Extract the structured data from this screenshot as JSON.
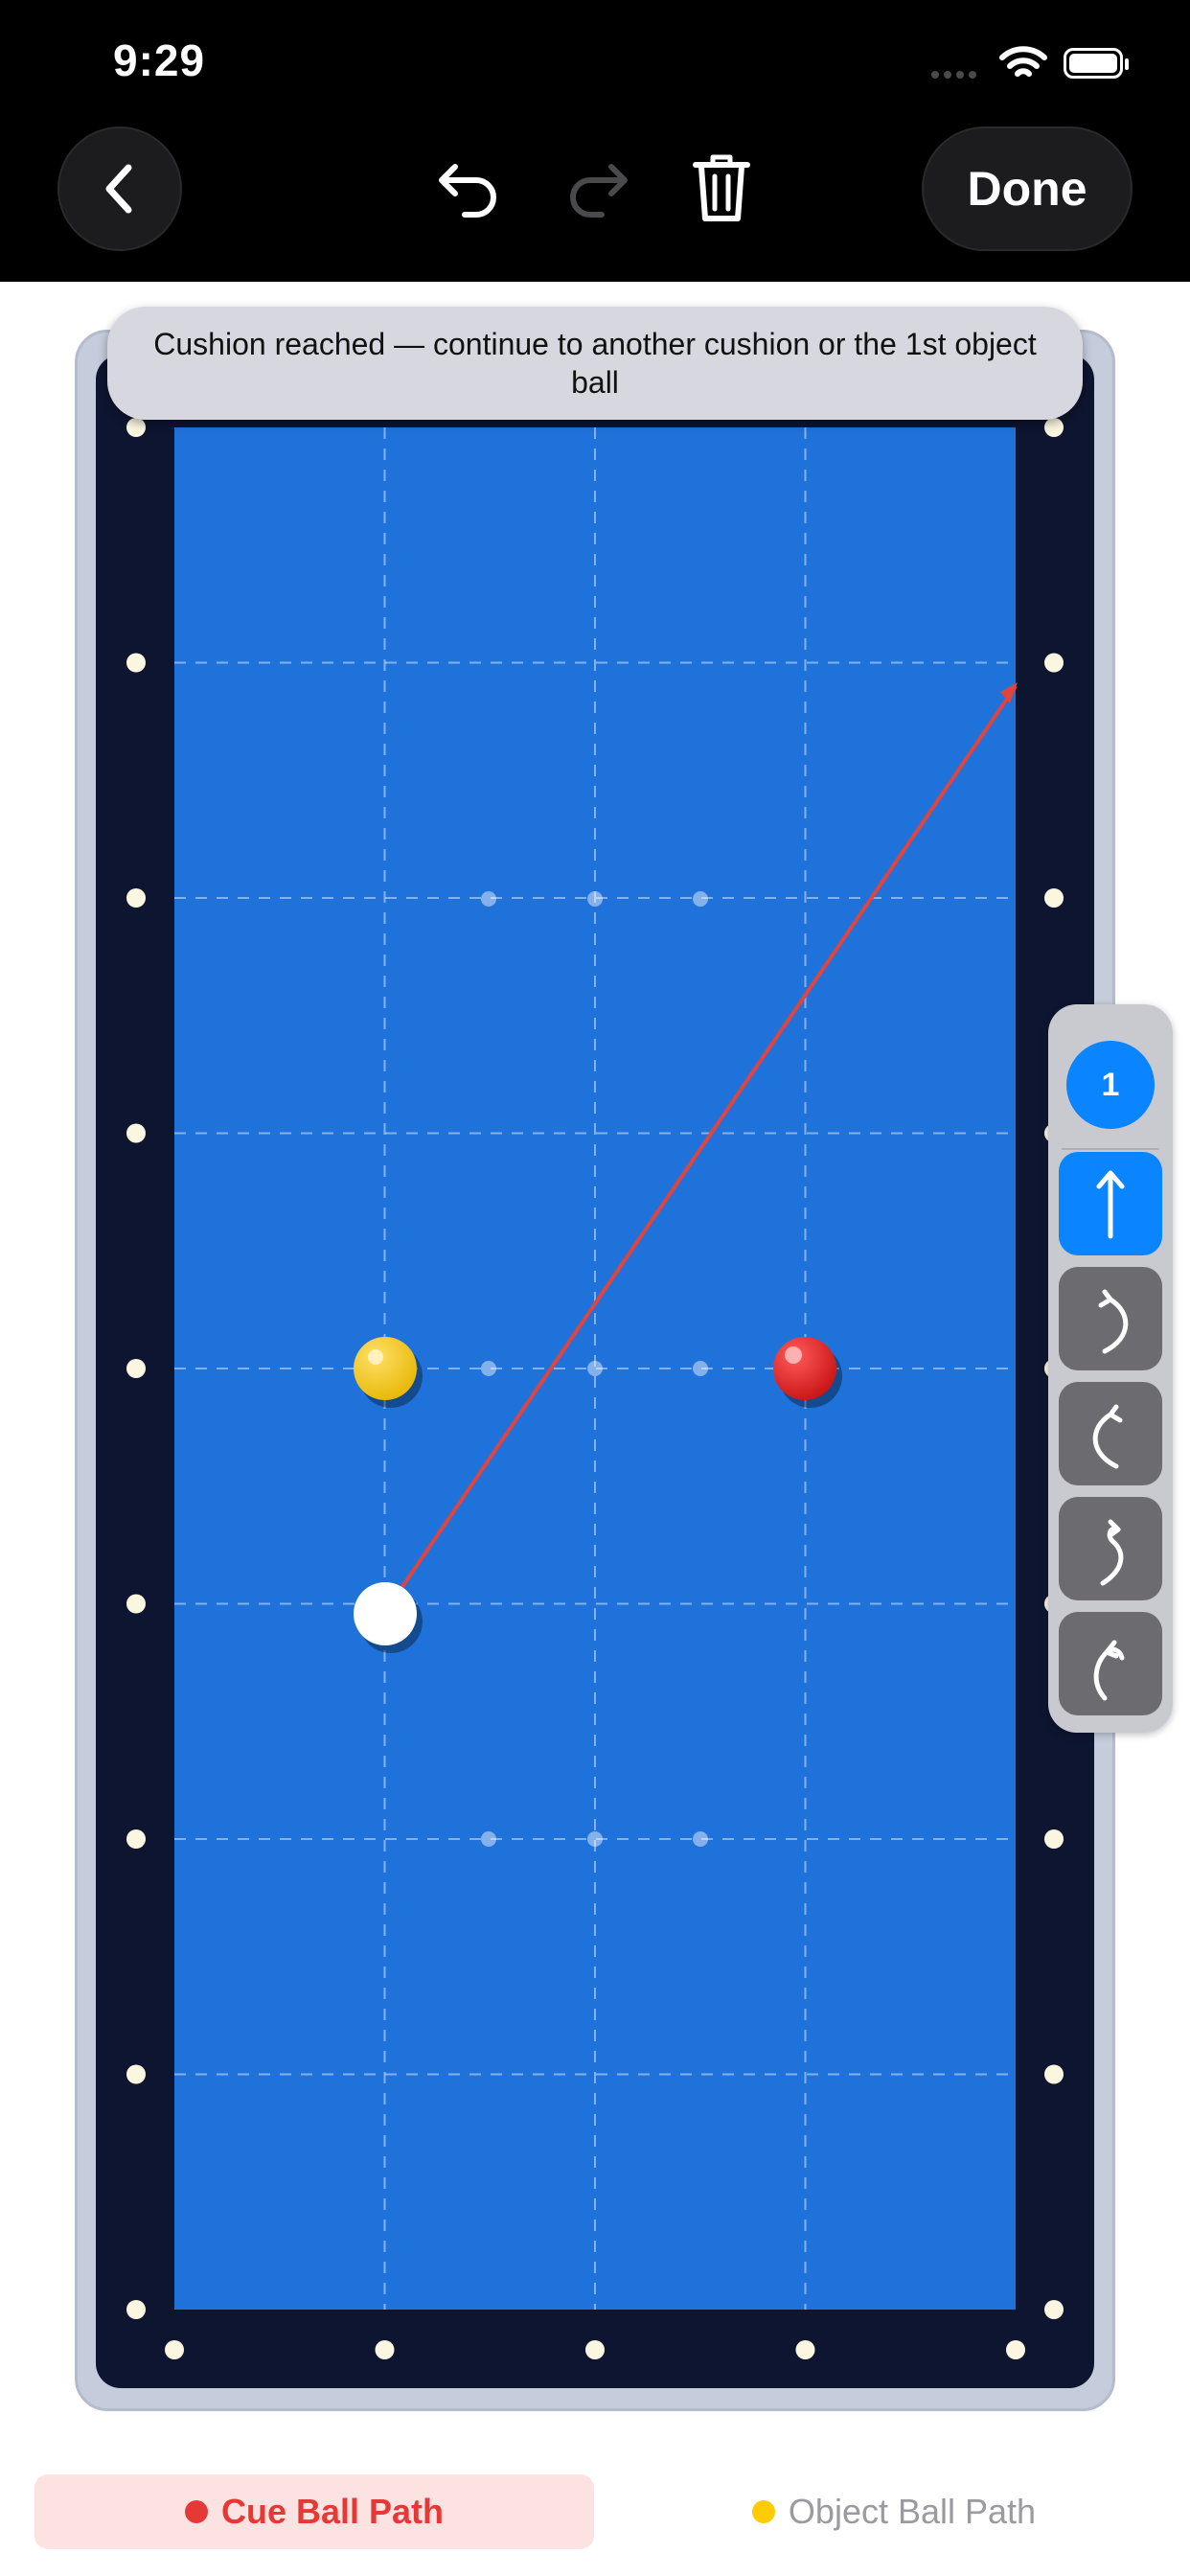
{
  "status_bar": {
    "time": "9:29"
  },
  "toolbar": {
    "done_label": "Done"
  },
  "notice": {
    "text": "Cushion reached — continue to another cushion or the 1st object ball"
  },
  "panel": {
    "shot_number": "1"
  },
  "tabs": [
    {
      "label": "Cue Ball Path",
      "dot_color": "#e53935"
    },
    {
      "label": "Object Ball Path",
      "dot_color": "#ffcc00"
    }
  ],
  "colors": {
    "felt": "#2072db",
    "rail": "#0e1530",
    "frame": "#c5ccdb",
    "path_line": "#e0443e",
    "accent": "#0a84ff",
    "yellow_ball": "#f5c400",
    "red_ball": "#e01b1b",
    "cue_ball": "#ffffff"
  },
  "icons": {
    "back": "chevron-left-icon",
    "undo": "undo-icon",
    "redo": "redo-icon",
    "delete": "trash-icon",
    "straight": "arrow-up-icon"
  }
}
